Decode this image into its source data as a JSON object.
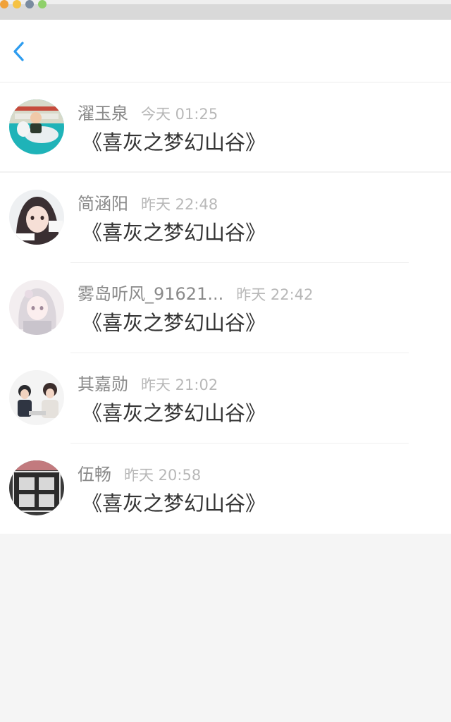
{
  "header": {
    "back_icon": "chevron-left-icon",
    "accent_color": "#2d9cef"
  },
  "items": [
    {
      "name": "濯玉泉",
      "time": "今天 01:25",
      "book": "《喜灰之梦幻山谷》",
      "avatar": "avatar-child-photo"
    },
    {
      "name": "简涵阳",
      "time": "昨天 22:48",
      "book": "《喜灰之梦幻山谷》",
      "avatar": "avatar-girl-photo"
    },
    {
      "name": "雾岛听风_91621...",
      "time": "昨天 22:42",
      "book": "《喜灰之梦幻山谷》",
      "avatar": "avatar-anime-girl"
    },
    {
      "name": "其嘉勋",
      "time": "昨天 21:02",
      "book": "《喜灰之梦幻山谷》",
      "avatar": "avatar-couple-photo"
    },
    {
      "name": "伍畅",
      "time": "昨天 20:58",
      "book": "《喜灰之梦幻山谷》",
      "avatar": "avatar-calligraphy"
    }
  ]
}
